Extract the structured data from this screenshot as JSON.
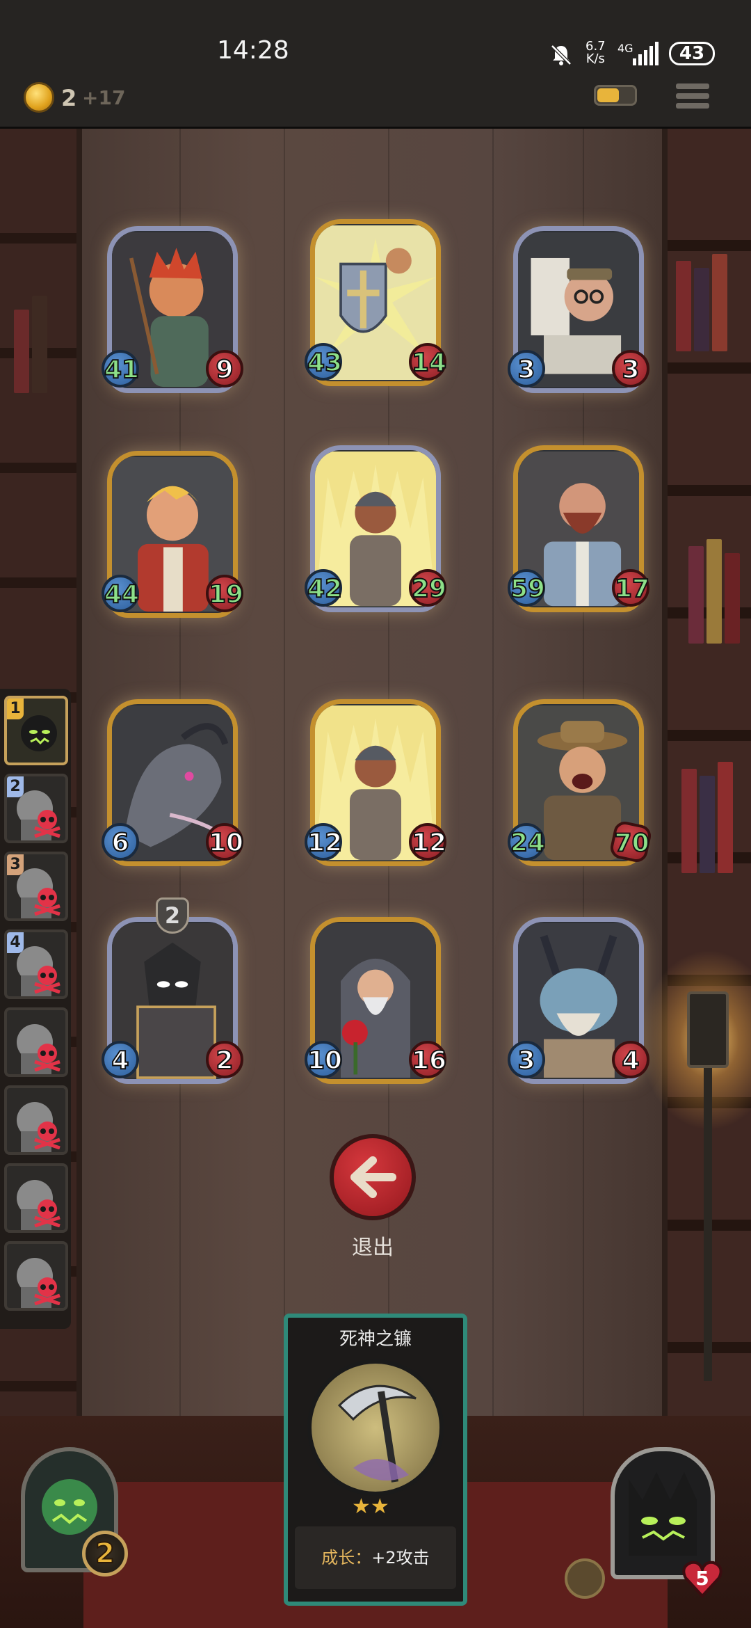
{
  "status_bar": {
    "time": "14:28",
    "net_speed_top": "6.7",
    "net_speed_bottom": "K/s",
    "network": "4G",
    "battery": "43"
  },
  "top_bar": {
    "coins": "2",
    "coin_gain": "+17",
    "energy_level": 0.6
  },
  "board": {
    "cards": [
      {
        "id": "archer",
        "atk": "41",
        "hp": "9",
        "frame": "silver",
        "atk_big": true
      },
      {
        "id": "shield-knight",
        "atk": "43",
        "hp": "14",
        "frame": "gold",
        "atk_big": true,
        "hp_big": true
      },
      {
        "id": "scholar",
        "atk": "3",
        "hp": "3",
        "frame": "silver"
      },
      {
        "id": "blond-warrior",
        "atk": "44",
        "hp": "19",
        "frame": "gold",
        "atk_big": true,
        "hp_big": true
      },
      {
        "id": "brute-a",
        "atk": "42",
        "hp": "29",
        "frame": "silver",
        "atk_big": true,
        "hp_big": true
      },
      {
        "id": "bearded-giant",
        "atk": "59",
        "hp": "17",
        "frame": "gold",
        "atk_big": true,
        "hp_big": true
      },
      {
        "id": "dragon",
        "atk": "6",
        "hp": "10",
        "frame": "gold"
      },
      {
        "id": "brute-b",
        "atk": "12",
        "hp": "12",
        "frame": "gold"
      },
      {
        "id": "adventurer",
        "atk": "24",
        "hp": "70",
        "frame": "gold",
        "atk_big": true,
        "hp_spiky": true
      },
      {
        "id": "dark-knight",
        "atk": "4",
        "hp": "2",
        "frame": "silver",
        "shield": "2"
      },
      {
        "id": "rose-monk",
        "atk": "10",
        "hp": "16",
        "frame": "gold"
      },
      {
        "id": "horned-beast",
        "atk": "3",
        "hp": "4",
        "frame": "silver"
      }
    ]
  },
  "exit": {
    "label": "退出"
  },
  "queue": {
    "slots": [
      {
        "num": "1",
        "color": "#e8b43b",
        "active": true
      },
      {
        "num": "2",
        "color": "#9fb9e8",
        "defeated": true
      },
      {
        "num": "3",
        "color": "#d3a27a",
        "defeated": true
      },
      {
        "num": "4",
        "color": "#9fb9e8",
        "defeated": true
      },
      {
        "num": "",
        "defeated": true
      },
      {
        "num": "",
        "defeated": true
      },
      {
        "num": "",
        "defeated": true
      },
      {
        "num": "",
        "defeated": true
      }
    ]
  },
  "item_card": {
    "title": "死神之镰",
    "stars": "★★",
    "desc_key": "成长：",
    "desc_value": "+2攻击"
  },
  "player": {
    "deck_count": "2"
  },
  "boss": {
    "hearts": "5"
  },
  "colors": {
    "gold_frame": "#c4902e",
    "silver_frame": "#8d93b5",
    "atk_blue": "#2d5f9d",
    "hp_red": "#8f1f26",
    "big_stat_green": "#8de089"
  }
}
